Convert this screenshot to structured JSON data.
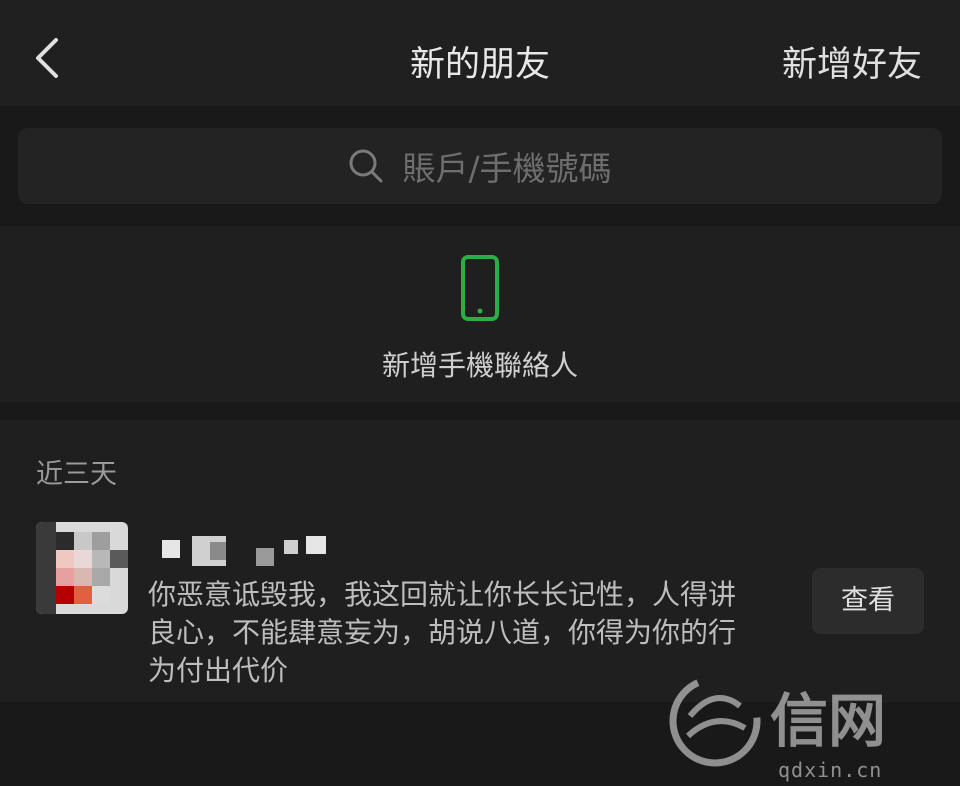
{
  "header": {
    "title": "新的朋友",
    "add_friend_label": "新增好友",
    "back_icon": "chevron-left-icon"
  },
  "search": {
    "placeholder": "賬戶/手機號碼",
    "icon": "search-icon"
  },
  "phone_contacts": {
    "label": "新增手機聯絡人",
    "icon": "phone-icon",
    "icon_color": "#2aae45"
  },
  "recent": {
    "heading": "近三天",
    "requests": [
      {
        "message": "你恶意诋毁我，我这回就让你长长记性，人得讲良心，不能肆意妄为，胡说八道，你得为你的行为付出代价",
        "button_label": "查看"
      }
    ]
  },
  "watermark": {
    "brand": "信网",
    "domain": "qdxin.cn"
  },
  "colors": {
    "background": "#191919",
    "header_bg": "#202020",
    "accent_green": "#2aae45"
  }
}
